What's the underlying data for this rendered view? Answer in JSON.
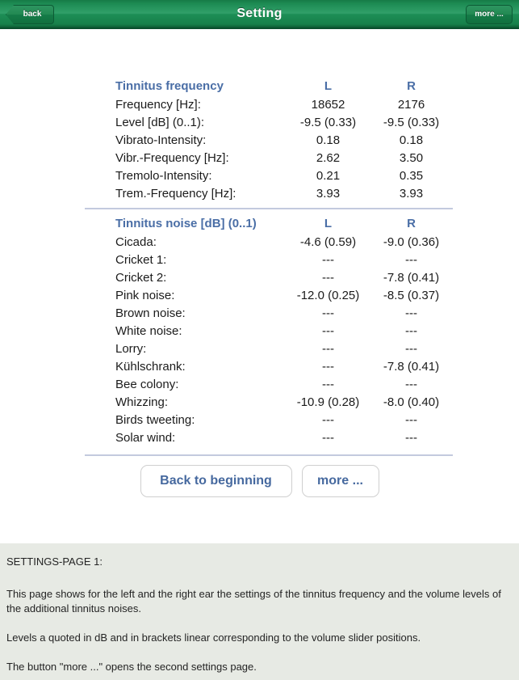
{
  "navbar": {
    "back_label": "back",
    "title": "Setting",
    "more_label": "more ...",
    "bar_color": "#1c8a52"
  },
  "arrow": {
    "name": "left-arrow",
    "fill": "#a5dd95",
    "stroke": "#5aa84f"
  },
  "frequency_table": {
    "heading": "Tinnitus frequency",
    "col_left": "L",
    "col_right": "R",
    "rows": [
      {
        "label": "Frequency [Hz]:",
        "L": "18652",
        "R": "2176"
      },
      {
        "label": "Level [dB] (0..1):",
        "L": "-9.5 (0.33)",
        "R": "-9.5 (0.33)"
      },
      {
        "label": "Vibrato-Intensity:",
        "L": "0.18",
        "R": "0.18"
      },
      {
        "label": "Vibr.-Frequency [Hz]:",
        "L": "2.62",
        "R": "3.50"
      },
      {
        "label": "Tremolo-Intensity:",
        "L": "0.21",
        "R": "0.35"
      },
      {
        "label": "Trem.-Frequency [Hz]:",
        "L": "3.93",
        "R": "3.93"
      }
    ]
  },
  "noise_table": {
    "heading": "Tinnitus noise [dB] (0..1)",
    "col_left": "L",
    "col_right": "R",
    "rows": [
      {
        "label": "Cicada:",
        "L": "-4.6 (0.59)",
        "R": "-9.0 (0.36)"
      },
      {
        "label": "Cricket 1:",
        "L": "---",
        "R": "---"
      },
      {
        "label": "Cricket 2:",
        "L": "---",
        "R": "-7.8 (0.41)"
      },
      {
        "label": "Pink noise:",
        "L": "-12.0 (0.25)",
        "R": "-8.5 (0.37)"
      },
      {
        "label": "Brown noise:",
        "L": "---",
        "R": "---"
      },
      {
        "label": "White noise:",
        "L": "---",
        "R": "---"
      },
      {
        "label": "Lorry:",
        "L": "---",
        "R": "---"
      },
      {
        "label": "Kühlschrank:",
        "L": "---",
        "R": "-7.8 (0.41)"
      },
      {
        "label": "Bee colony:",
        "L": "---",
        "R": "---"
      },
      {
        "label": "Whizzing:",
        "L": "-10.9 (0.28)",
        "R": "-8.0 (0.40)"
      },
      {
        "label": "Birds tweeting:",
        "L": "---",
        "R": "---"
      },
      {
        "label": "Solar wind:",
        "L": "---",
        "R": "---"
      }
    ]
  },
  "actions": {
    "back_to_beginning": "Back to beginning",
    "more": "more ...",
    "text_color": "#46699f"
  },
  "help": {
    "title": "SETTINGS-PAGE 1:",
    "paragraph1": "This page shows for the left and the right ear the settings of the tinnitus frequency and the volume levels of the additional tinnitus noises.",
    "paragraph2": "Levels a quoted in dB and in brackets linear corresponding to the volume slider positions.",
    "paragraph3": "The button \"more ...\" opens the second settings page.",
    "background": "#e7eae4"
  }
}
